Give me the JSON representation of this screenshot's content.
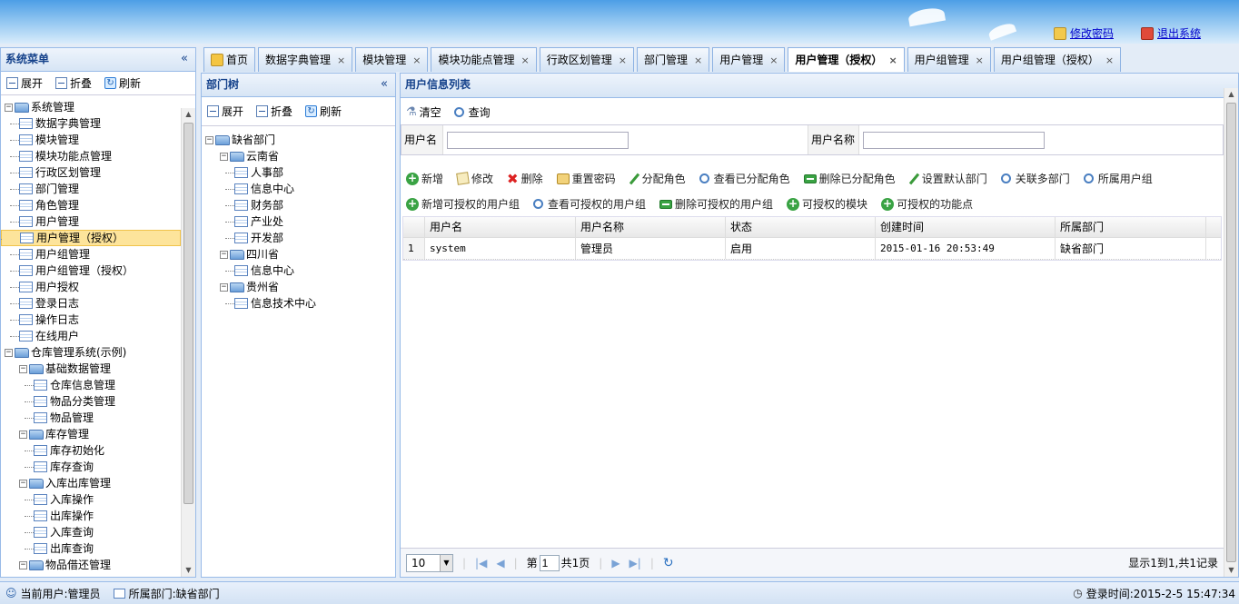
{
  "header": {
    "change_password": "修改密码",
    "logout": "退出系统",
    "accent": "#4d9ee6"
  },
  "sysmenu": {
    "title": "系统菜单",
    "collapse": "«",
    "expand_label": "展开",
    "fold_label": "折叠",
    "refresh_label": "刷新",
    "items": [
      {
        "label": "系统管理",
        "level": 0,
        "type": "folder"
      },
      {
        "label": "数据字典管理",
        "level": 1,
        "type": "leaf"
      },
      {
        "label": "模块管理",
        "level": 1,
        "type": "leaf"
      },
      {
        "label": "模块功能点管理",
        "level": 1,
        "type": "leaf"
      },
      {
        "label": "行政区划管理",
        "level": 1,
        "type": "leaf"
      },
      {
        "label": "部门管理",
        "level": 1,
        "type": "leaf"
      },
      {
        "label": "角色管理",
        "level": 1,
        "type": "leaf"
      },
      {
        "label": "用户管理",
        "level": 1,
        "type": "leaf"
      },
      {
        "label": "用户管理（授权）",
        "level": 1,
        "type": "leaf",
        "selected": true
      },
      {
        "label": "用户组管理",
        "level": 1,
        "type": "leaf"
      },
      {
        "label": "用户组管理（授权）",
        "level": 1,
        "type": "leaf"
      },
      {
        "label": "用户授权",
        "level": 1,
        "type": "leaf"
      },
      {
        "label": "登录日志",
        "level": 1,
        "type": "leaf"
      },
      {
        "label": "操作日志",
        "level": 1,
        "type": "leaf"
      },
      {
        "label": "在线用户",
        "level": 1,
        "type": "leaf"
      },
      {
        "label": "仓库管理系统(示例)",
        "level": 0,
        "type": "folder"
      },
      {
        "label": "基础数据管理",
        "level": 1,
        "type": "folder"
      },
      {
        "label": "仓库信息管理",
        "level": 2,
        "type": "leaf"
      },
      {
        "label": "物品分类管理",
        "level": 2,
        "type": "leaf"
      },
      {
        "label": "物品管理",
        "level": 2,
        "type": "leaf"
      },
      {
        "label": "库存管理",
        "level": 1,
        "type": "folder"
      },
      {
        "label": "库存初始化",
        "level": 2,
        "type": "leaf"
      },
      {
        "label": "库存查询",
        "level": 2,
        "type": "leaf"
      },
      {
        "label": "入库出库管理",
        "level": 1,
        "type": "folder"
      },
      {
        "label": "入库操作",
        "level": 2,
        "type": "leaf"
      },
      {
        "label": "出库操作",
        "level": 2,
        "type": "leaf"
      },
      {
        "label": "入库查询",
        "level": 2,
        "type": "leaf"
      },
      {
        "label": "出库查询",
        "level": 2,
        "type": "leaf"
      },
      {
        "label": "物品借还管理",
        "level": 1,
        "type": "folder"
      }
    ]
  },
  "tabs": [
    {
      "label": "首页",
      "closable": false
    },
    {
      "label": "数据字典管理",
      "closable": true
    },
    {
      "label": "模块管理",
      "closable": true
    },
    {
      "label": "模块功能点管理",
      "closable": true
    },
    {
      "label": "行政区划管理",
      "closable": true
    },
    {
      "label": "部门管理",
      "closable": true
    },
    {
      "label": "用户管理",
      "closable": true
    },
    {
      "label": "用户管理（授权）",
      "closable": true,
      "active": true
    },
    {
      "label": "用户组管理",
      "closable": true
    },
    {
      "label": "用户组管理（授权）",
      "closable": true
    }
  ],
  "close_glyph": "×",
  "depttree": {
    "title": "部门树",
    "collapse": "«",
    "expand_label": "展开",
    "fold_label": "折叠",
    "refresh_label": "刷新",
    "items": [
      {
        "label": "缺省部门",
        "level": 0,
        "type": "folder"
      },
      {
        "label": "云南省",
        "level": 1,
        "type": "folder"
      },
      {
        "label": "人事部",
        "level": 2,
        "type": "leaf"
      },
      {
        "label": "信息中心",
        "level": 2,
        "type": "leaf"
      },
      {
        "label": "财务部",
        "level": 2,
        "type": "leaf"
      },
      {
        "label": "产业处",
        "level": 2,
        "type": "leaf"
      },
      {
        "label": "开发部",
        "level": 2,
        "type": "leaf"
      },
      {
        "label": "四川省",
        "level": 1,
        "type": "folder"
      },
      {
        "label": "信息中心",
        "level": 2,
        "type": "leaf"
      },
      {
        "label": "贵州省",
        "level": 1,
        "type": "folder"
      },
      {
        "label": "信息技术中心",
        "level": 2,
        "type": "leaf"
      }
    ]
  },
  "userlist": {
    "title": "用户信息列表",
    "clear_label": "清空",
    "query_label": "查询",
    "username_label": "用户名",
    "username_value": "",
    "fullname_label": "用户名称",
    "fullname_value": "",
    "actions_row1": [
      "新增",
      "修改",
      "删除",
      "重置密码",
      "分配角色",
      "查看已分配角色",
      "删除已分配角色",
      "设置默认部门",
      "关联多部门",
      "所属用户组"
    ],
    "actions_row2": [
      "新增可授权的用户组",
      "查看可授权的用户组",
      "删除可授权的用户组",
      "可授权的模块",
      "可授权的功能点"
    ],
    "columns": [
      "用户名",
      "用户名称",
      "状态",
      "创建时间",
      "所属部门"
    ],
    "rows": [
      {
        "num": "1",
        "cells": [
          "system",
          "管理员",
          "启用",
          "2015-01-16 20:53:49",
          "缺省部门"
        ]
      }
    ],
    "pager": {
      "page_size": "10",
      "page_prefix": "第",
      "page": "1",
      "page_suffix": "共1页",
      "summary": "显示1到1,共1记录"
    }
  },
  "status": {
    "current_user": "当前用户:管理员",
    "department": "所属部门:缺省部门",
    "login_time": "登录时间:2015-2-5 15:47:34"
  }
}
